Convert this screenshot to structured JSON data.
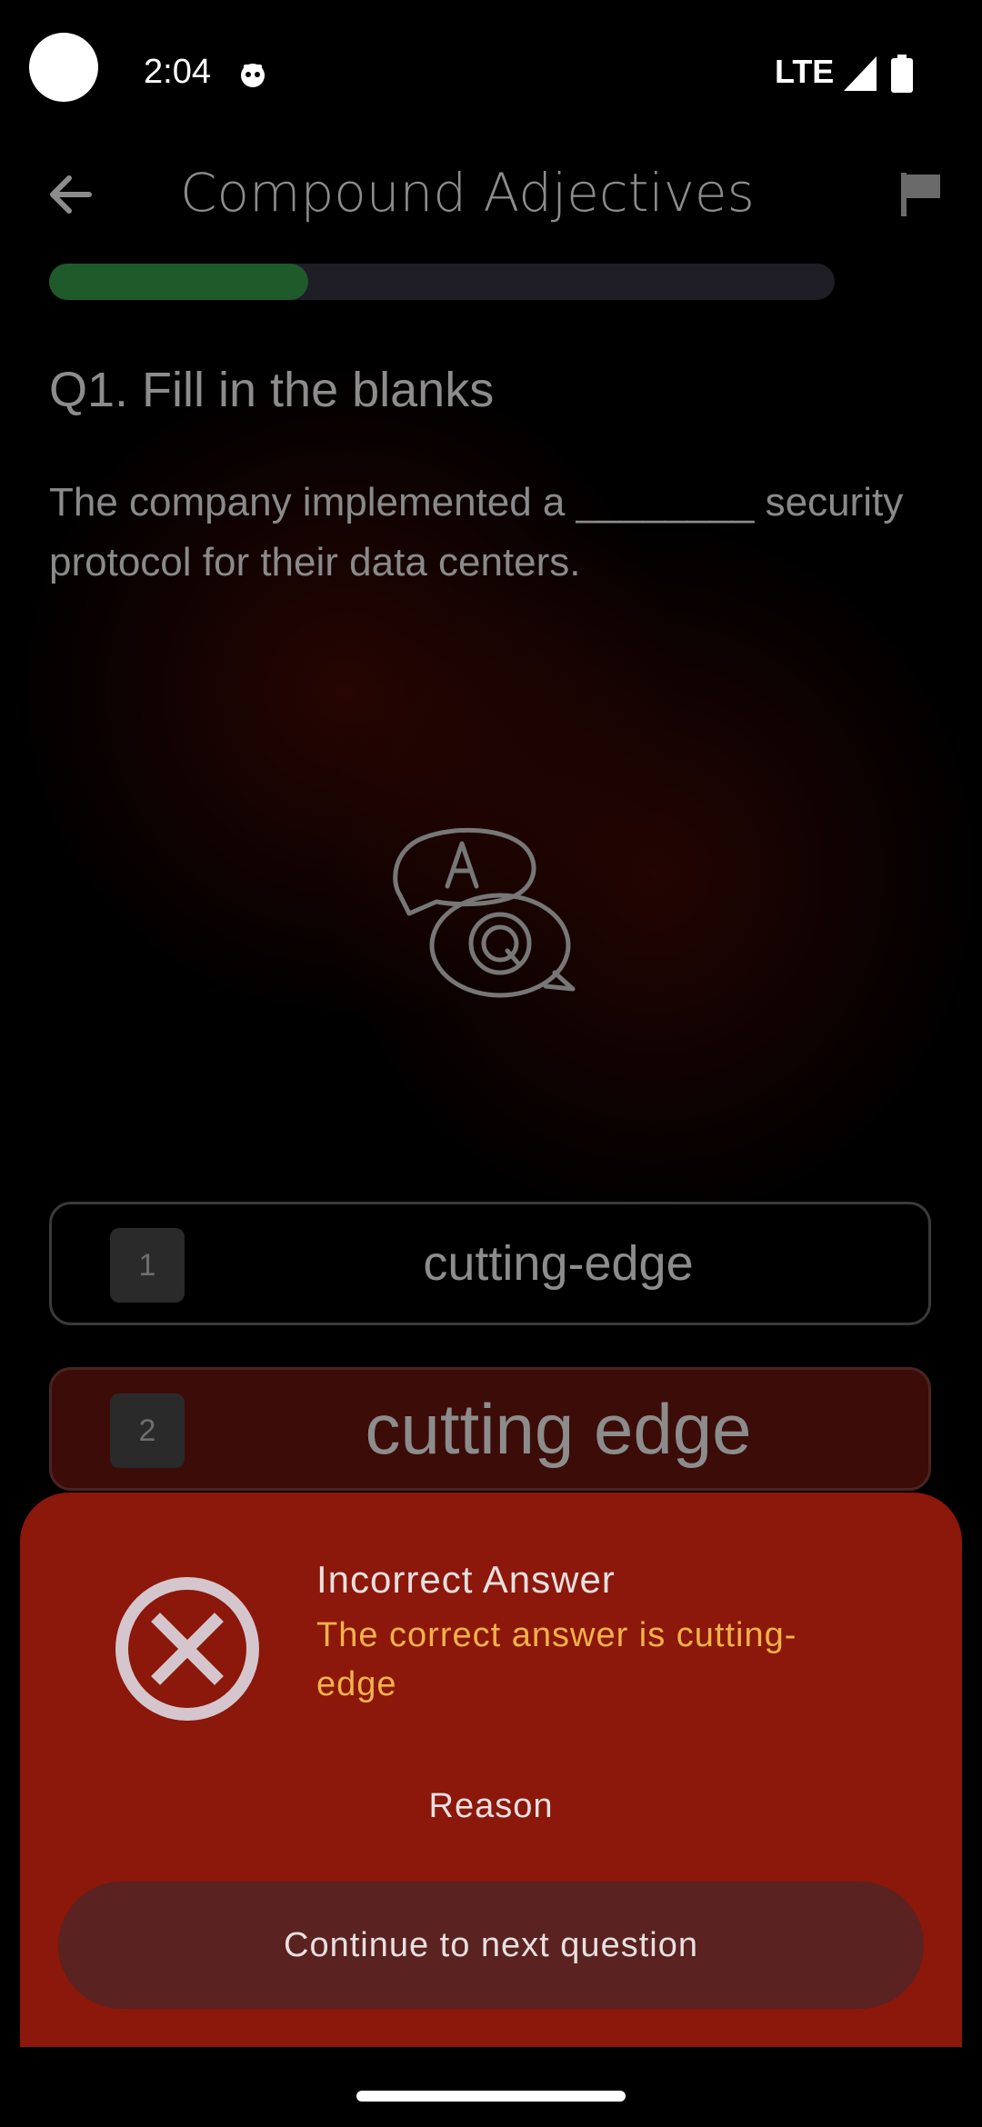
{
  "status_bar": {
    "time": "2:04",
    "network": "LTE"
  },
  "app_bar": {
    "title": "Compound Adjectives"
  },
  "progress": {
    "fraction": 0.33
  },
  "question": {
    "label": "Q1. Fill in the blanks",
    "text": "The company implemented a ________ security protocol for their data centers."
  },
  "options": [
    {
      "number": "1",
      "text": "cutting-edge"
    },
    {
      "number": "2",
      "text": "cutting edge"
    }
  ],
  "feedback": {
    "title": "Incorrect Answer",
    "subtitle": "The correct answer is cutting-edge",
    "reason": "Reason",
    "continue": "Continue to next question"
  },
  "colors": {
    "progress_fill": "#1f5a2b",
    "sheet_bg": "#8c170b",
    "subtitle_accent": "#f2b24a",
    "selected_option_bg": "#3b0c08"
  }
}
